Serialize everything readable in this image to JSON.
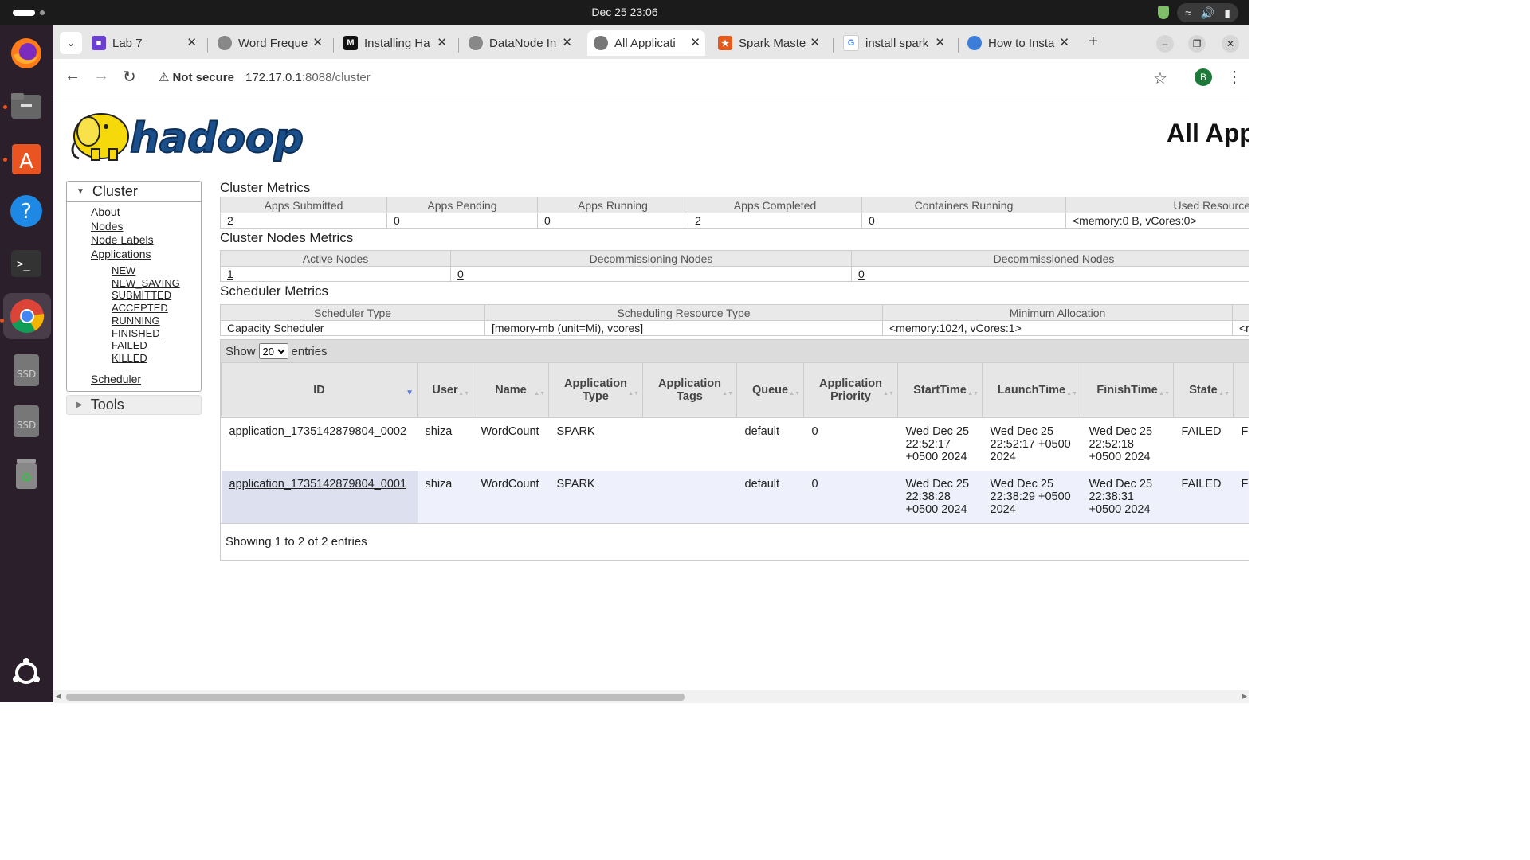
{
  "system": {
    "clock": "Dec 25  23:06"
  },
  "browser": {
    "tabs": [
      {
        "title": "Lab 7",
        "favicon": "lab-icon"
      },
      {
        "title": "Word Freque",
        "favicon": "globe-icon"
      },
      {
        "title": "Installing Ha",
        "favicon": "medium-icon"
      },
      {
        "title": "DataNode In",
        "favicon": "globe-icon"
      },
      {
        "title": "All Applicati",
        "favicon": "globe-icon",
        "active": true
      },
      {
        "title": "Spark Maste",
        "favicon": "spark-icon"
      },
      {
        "title": "install spark",
        "favicon": "google-icon"
      },
      {
        "title": "How to Insta",
        "favicon": "globe-icon"
      }
    ],
    "address": {
      "not_secure": "Not secure",
      "host": "172.17.0.1",
      "path": ":8088/cluster"
    },
    "profile_initial": "B"
  },
  "page": {
    "logo_text": "hadoop",
    "title": "All Applications"
  },
  "nav": {
    "cluster_label": "Cluster",
    "links": [
      "About",
      "Nodes",
      "Node Labels",
      "Applications"
    ],
    "app_states": [
      "NEW",
      "NEW_SAVING",
      "SUBMITTED",
      "ACCEPTED",
      "RUNNING",
      "FINISHED",
      "FAILED",
      "KILLED"
    ],
    "scheduler": "Scheduler",
    "tools_label": "Tools"
  },
  "cluster_metrics": {
    "title": "Cluster Metrics",
    "headers": [
      "Apps Submitted",
      "Apps Pending",
      "Apps Running",
      "Apps Completed",
      "Containers Running",
      "Used Resources"
    ],
    "values": [
      "2",
      "0",
      "0",
      "2",
      "0",
      "<memory:0 B, vCores:0>"
    ]
  },
  "node_metrics": {
    "title": "Cluster Nodes Metrics",
    "headers": [
      "Active Nodes",
      "Decommissioning Nodes",
      "Decommissioned Nodes"
    ],
    "values": [
      "1",
      "0",
      "0"
    ]
  },
  "scheduler_metrics": {
    "title": "Scheduler Metrics",
    "headers": [
      "Scheduler Type",
      "Scheduling Resource Type",
      "Minimum Allocation",
      ""
    ],
    "values": [
      "Capacity Scheduler",
      "[memory-mb (unit=Mi), vcores]",
      "<memory:1024, vCores:1>",
      "<r"
    ]
  },
  "apps": {
    "show_label": "Show",
    "entries_label": "entries",
    "page_size": "20",
    "headers": [
      "ID",
      "User",
      "Name",
      "Application Type",
      "Application Tags",
      "Queue",
      "Application Priority",
      "StartTime",
      "LaunchTime",
      "FinishTime",
      "State",
      ""
    ],
    "rows": [
      [
        "application_1735142879804_0002",
        "shiza",
        "WordCount",
        "SPARK",
        "",
        "default",
        "0",
        "Wed Dec 25 22:52:17 +0500 2024",
        "Wed Dec 25 22:52:17 +0500 2024",
        "Wed Dec 25 22:52:18 +0500 2024",
        "FAILED",
        "F"
      ],
      [
        "application_1735142879804_0001",
        "shiza",
        "WordCount",
        "SPARK",
        "",
        "default",
        "0",
        "Wed Dec 25 22:38:28 +0500 2024",
        "Wed Dec 25 22:38:29 +0500 2024",
        "Wed Dec 25 22:38:31 +0500 2024",
        "FAILED",
        "F"
      ]
    ],
    "footer": "Showing 1 to 2 of 2 entries"
  },
  "colors": {
    "accent": "#e95420",
    "hadoop_blue": "#1b4f8a",
    "hadoop_yellow": "#f5d90a"
  }
}
